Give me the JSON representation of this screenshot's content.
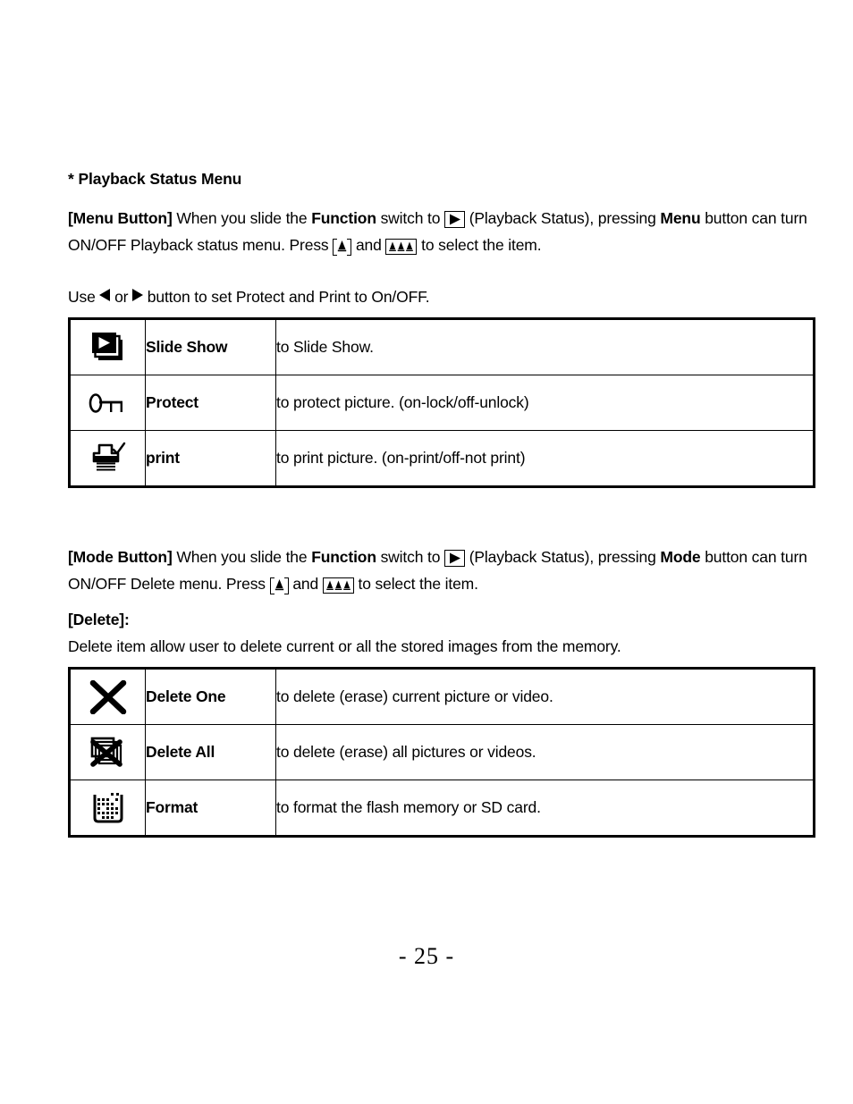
{
  "document": {
    "page_number": "- 25 -",
    "section_heading": "* Playback Status Menu"
  },
  "menu_button_paragraph": {
    "lead": "[Menu Button]",
    "t1": " When you slide the ",
    "bold1": "Function",
    "t2": " switch to ",
    "icon1": "playback-status-icon",
    "t3": " (Playback Status), pressing ",
    "bold2": "Menu",
    "t4": " button can turn ON/OFF Playback status menu. Press ",
    "icon2": "zoom-in-icon",
    "t5": " and ",
    "icon3": "thumbnail-zoom-out-icon",
    "t6": " to select the item."
  },
  "use_arrows_line": {
    "t1": "Use ",
    "icon_left": "arrow-left-icon",
    "t2": " or ",
    "icon_right": "arrow-right-icon",
    "t3": " button to set Protect and Print to On/OFF."
  },
  "playback_status_table": {
    "rows": [
      {
        "icon": "slide-show-icon",
        "label": "Slide Show",
        "description": "to Slide Show."
      },
      {
        "icon": "key-protect-icon",
        "label": "Protect",
        "description": "to protect picture. (on-lock/off-unlock)"
      },
      {
        "icon": "printer-check-icon",
        "label": "print",
        "description": "to print picture. (on-print/off-not print)"
      }
    ]
  },
  "mode_button_paragraph": {
    "lead": "[Mode Button]",
    "t1": " When you slide the ",
    "bold1": "Function",
    "t2": " switch to ",
    "icon1": "playback-status-icon",
    "t3": " (Playback Status), pressing ",
    "bold2": "Mode",
    "t4": " button can turn ON/OFF Delete menu. Press ",
    "icon2": "zoom-in-icon",
    "t5": "  and ",
    "icon3": "thumbnail-zoom-out-icon",
    "t6": "  to select the item."
  },
  "delete_section": {
    "heading": "[Delete]:",
    "description": "Delete item allow user to delete current or all the stored images from the memory."
  },
  "delete_table": {
    "rows": [
      {
        "icon": "delete-one-x-icon",
        "label": "Delete One",
        "description": "to delete (erase) current picture or video."
      },
      {
        "icon": "delete-all-icon",
        "label": "Delete All",
        "description": "to delete (erase) all pictures or videos."
      },
      {
        "icon": "format-memory-icon",
        "label": "Format",
        "description": "to format the flash memory or SD card."
      }
    ]
  },
  "colors": {
    "ink": "#000000",
    "paper": "#ffffff"
  }
}
